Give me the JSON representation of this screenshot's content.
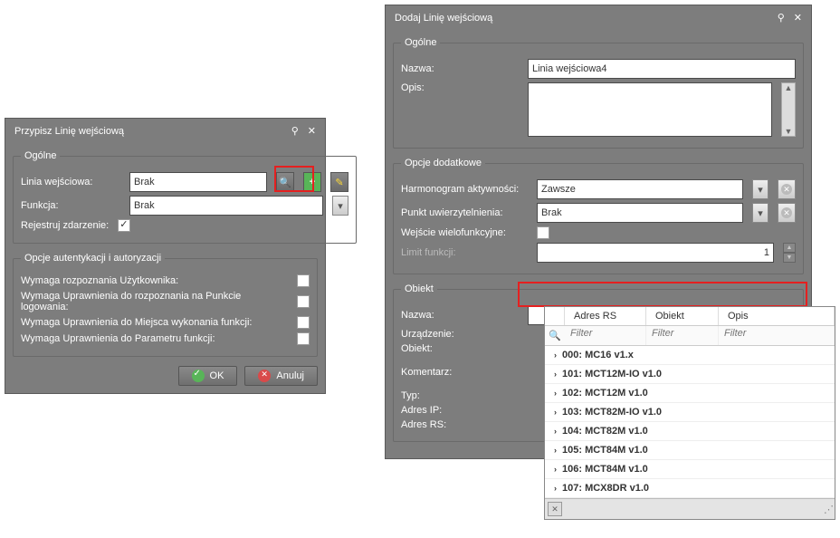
{
  "dlg1": {
    "title": "Przypisz Linię wejściową",
    "fs_general": "Ogólne",
    "linia_label": "Linia wejściowa:",
    "linia_value": "Brak",
    "funkcja_label": "Funkcja:",
    "funkcja_value": "Brak",
    "rejestruj_label": "Rejestruj zdarzenie:",
    "fs_auth": "Opcje autentykacji i autoryzacji",
    "auth1": "Wymaga rozpoznania Użytkownika:",
    "auth2": "Wymaga Uprawnienia do rozpoznania na Punkcie logowania:",
    "auth3": "Wymaga Uprawnienia do Miejsca wykonania funkcji:",
    "auth4": "Wymaga Uprawnienia do Parametru funkcji:",
    "ok": "OK",
    "anuluj": "Anuluj"
  },
  "dlg2": {
    "title": "Dodaj Linię wejściową",
    "fs_general": "Ogólne",
    "nazwa_label": "Nazwa:",
    "nazwa_value": "Linia wejściowa4",
    "opis_label": "Opis:",
    "opis_value": "",
    "fs_extra": "Opcje dodatkowe",
    "harm_label": "Harmonogram aktywności:",
    "harm_value": "Zawsze",
    "punkt_label": "Punkt uwierzytelnienia:",
    "punkt_value": "Brak",
    "wielo_label": "Wejście wielofunkcyjne:",
    "limit_label": "Limit funkcji:",
    "limit_value": "1",
    "fs_obiekt": "Obiekt",
    "obj_nazwa_label": "Nazwa:",
    "urz_label": "Urządzenie:",
    "obiekt_label": "Obiekt:",
    "koment_label": "Komentarz:",
    "typ_label": "Typ:",
    "adresip_label": "Adres IP:",
    "adresrs_label": "Adres RS:"
  },
  "popup": {
    "col1": "Adres RS",
    "col2": "Obiekt",
    "col3": "Opis",
    "filter_placeholder": "Filter",
    "items": [
      "000: MC16 v1.x",
      "101: MCT12M-IO v1.0",
      "102: MCT12M v1.0",
      "103: MCT82M-IO v1.0",
      "104: MCT82M v1.0",
      "105: MCT84M v1.0",
      "106: MCT84M v1.0",
      "107: MCX8DR v1.0"
    ]
  }
}
